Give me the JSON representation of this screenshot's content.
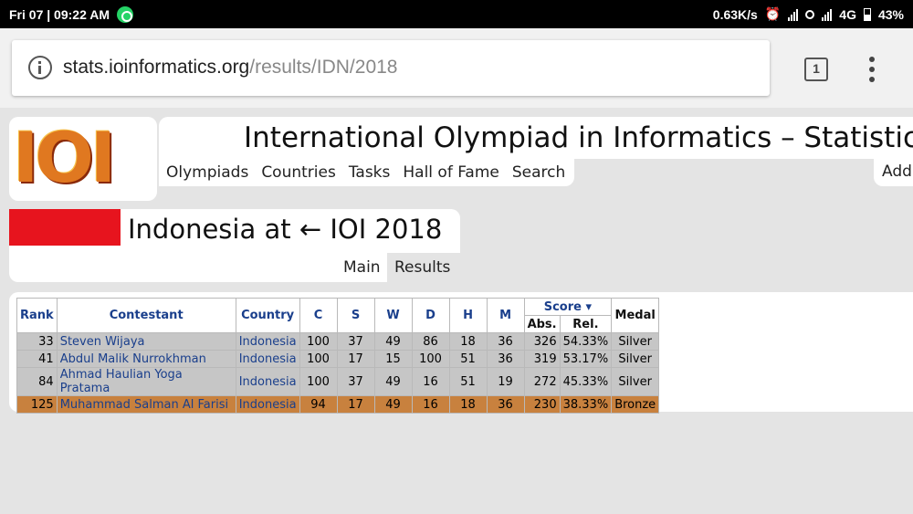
{
  "status_bar": {
    "datetime": "Fri 07 | 09:22 AM",
    "net_speed": "0.63K/s",
    "network": "4G",
    "battery": "43%"
  },
  "browser": {
    "url_host": "stats.ioinformatics.org",
    "url_path": "/results/IDN/2018",
    "tab_count": "1"
  },
  "site": {
    "logo_text": "IOI",
    "title": "International Olympiad in Informatics – Statistics",
    "nav": [
      "Olympiads",
      "Countries",
      "Tasks",
      "Hall of Fame",
      "Search"
    ],
    "nav_right": "Add"
  },
  "page": {
    "title": "Indonesia at ← IOI 2018",
    "tabs": [
      "Main",
      "Results"
    ],
    "active_tab": "Results"
  },
  "table": {
    "headers": {
      "rank": "Rank",
      "contestant": "Contestant",
      "country": "Country",
      "tasks": [
        "C",
        "S",
        "W",
        "D",
        "H",
        "M"
      ],
      "score": "Score ▾",
      "abs": "Abs.",
      "rel": "Rel.",
      "medal": "Medal"
    },
    "rows": [
      {
        "rank": "33",
        "name": "Steven Wijaya",
        "country": "Indonesia",
        "scores": [
          "100",
          "37",
          "49",
          "86",
          "18",
          "36"
        ],
        "abs": "326",
        "rel": "54.33%",
        "medal": "Silver"
      },
      {
        "rank": "41",
        "name": "Abdul Malik Nurrokhman",
        "country": "Indonesia",
        "scores": [
          "100",
          "17",
          "15",
          "100",
          "51",
          "36"
        ],
        "abs": "319",
        "rel": "53.17%",
        "medal": "Silver"
      },
      {
        "rank": "84",
        "name": "Ahmad Haulian Yoga Pratama",
        "country": "Indonesia",
        "scores": [
          "100",
          "37",
          "49",
          "16",
          "51",
          "19"
        ],
        "abs": "272",
        "rel": "45.33%",
        "medal": "Silver"
      },
      {
        "rank": "125",
        "name": "Muhammad Salman Al Farisi",
        "country": "Indonesia",
        "scores": [
          "94",
          "17",
          "49",
          "16",
          "18",
          "36"
        ],
        "abs": "230",
        "rel": "38.33%",
        "medal": "Bronze"
      }
    ]
  },
  "colors": {
    "silver_row": "#c6c6c6",
    "bronze_row": "#c8813e",
    "link": "#1a3f8c",
    "flag_red": "#e7141e"
  }
}
